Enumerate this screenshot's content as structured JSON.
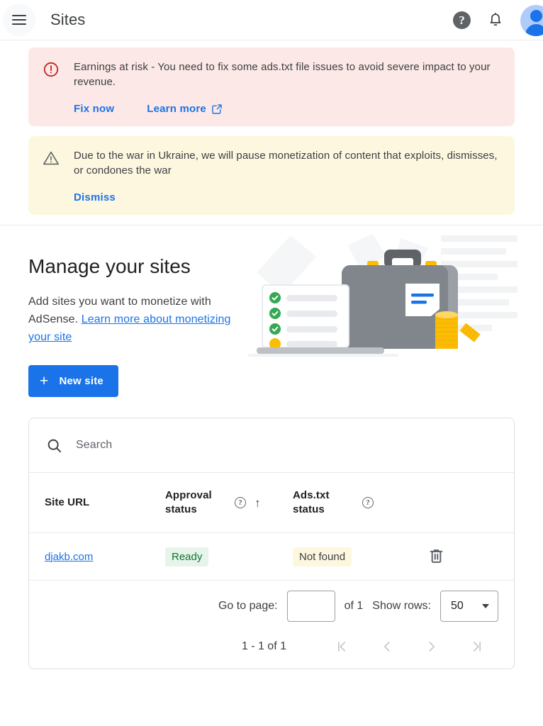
{
  "header": {
    "title": "Sites",
    "menu_icon": "hamburger-menu-icon",
    "help_icon_label": "?",
    "bell_icon": "notifications-bell-icon",
    "avatar_icon": "account-avatar"
  },
  "banners": [
    {
      "type": "error",
      "icon": "error-circle-icon",
      "message": "Earnings at risk - You need to fix some ads.txt file issues to avoid severe impact to your revenue.",
      "actions": [
        {
          "label": "Fix now",
          "external": false
        },
        {
          "label": "Learn more",
          "external": true
        }
      ],
      "bg_color": "#fce8e6",
      "icon_color": "#c5221f"
    },
    {
      "type": "warning",
      "icon": "warning-triangle-icon",
      "message": "Due to the war in Ukraine, we will pause monetization of content that exploits, dismisses, or condones the war",
      "actions": [
        {
          "label": "Dismiss",
          "external": false
        }
      ],
      "bg_color": "#fef7e0",
      "icon_color": "#5f6368"
    }
  ],
  "hero": {
    "title": "Manage your sites",
    "description_prefix": "Add sites you want to monetize with AdSense. ",
    "description_link": "Learn more about monetizing your site",
    "illustration": "briefcase-laptop-coins-illustration"
  },
  "new_site_button": {
    "label": "New site",
    "icon": "plus-icon",
    "color": "#1a73e8"
  },
  "search": {
    "placeholder": "Search",
    "icon": "search-icon",
    "value": ""
  },
  "table": {
    "columns": [
      {
        "label": "Site URL",
        "help": false,
        "sorted": false
      },
      {
        "label": "Approval status",
        "help": true,
        "help_icon": "help-circle-icon",
        "sorted": true,
        "sort_icon": "arrow-up-icon"
      },
      {
        "label": "Ads.txt status",
        "help": true,
        "help_icon": "help-circle-icon",
        "sorted": false
      },
      {
        "label": "",
        "help": false,
        "sorted": false
      }
    ],
    "rows": [
      {
        "site_url": "djakb.com",
        "approval_status": "Ready",
        "approval_status_color": "#137333",
        "approval_status_bg": "#e6f4ea",
        "ads_txt_status": "Not found",
        "ads_txt_status_bg": "#fef7e0",
        "delete_icon": "trash-icon"
      }
    ]
  },
  "pagination": {
    "go_to_page_label": "Go to page:",
    "page_value": "",
    "of_label": "of 1",
    "show_rows_label": "Show rows:",
    "rows_per_page": "50",
    "range_label": "1 - 1 of 1",
    "first_icon": "first-page-icon",
    "prev_icon": "previous-page-icon",
    "next_icon": "next-page-icon",
    "last_icon": "last-page-icon"
  }
}
